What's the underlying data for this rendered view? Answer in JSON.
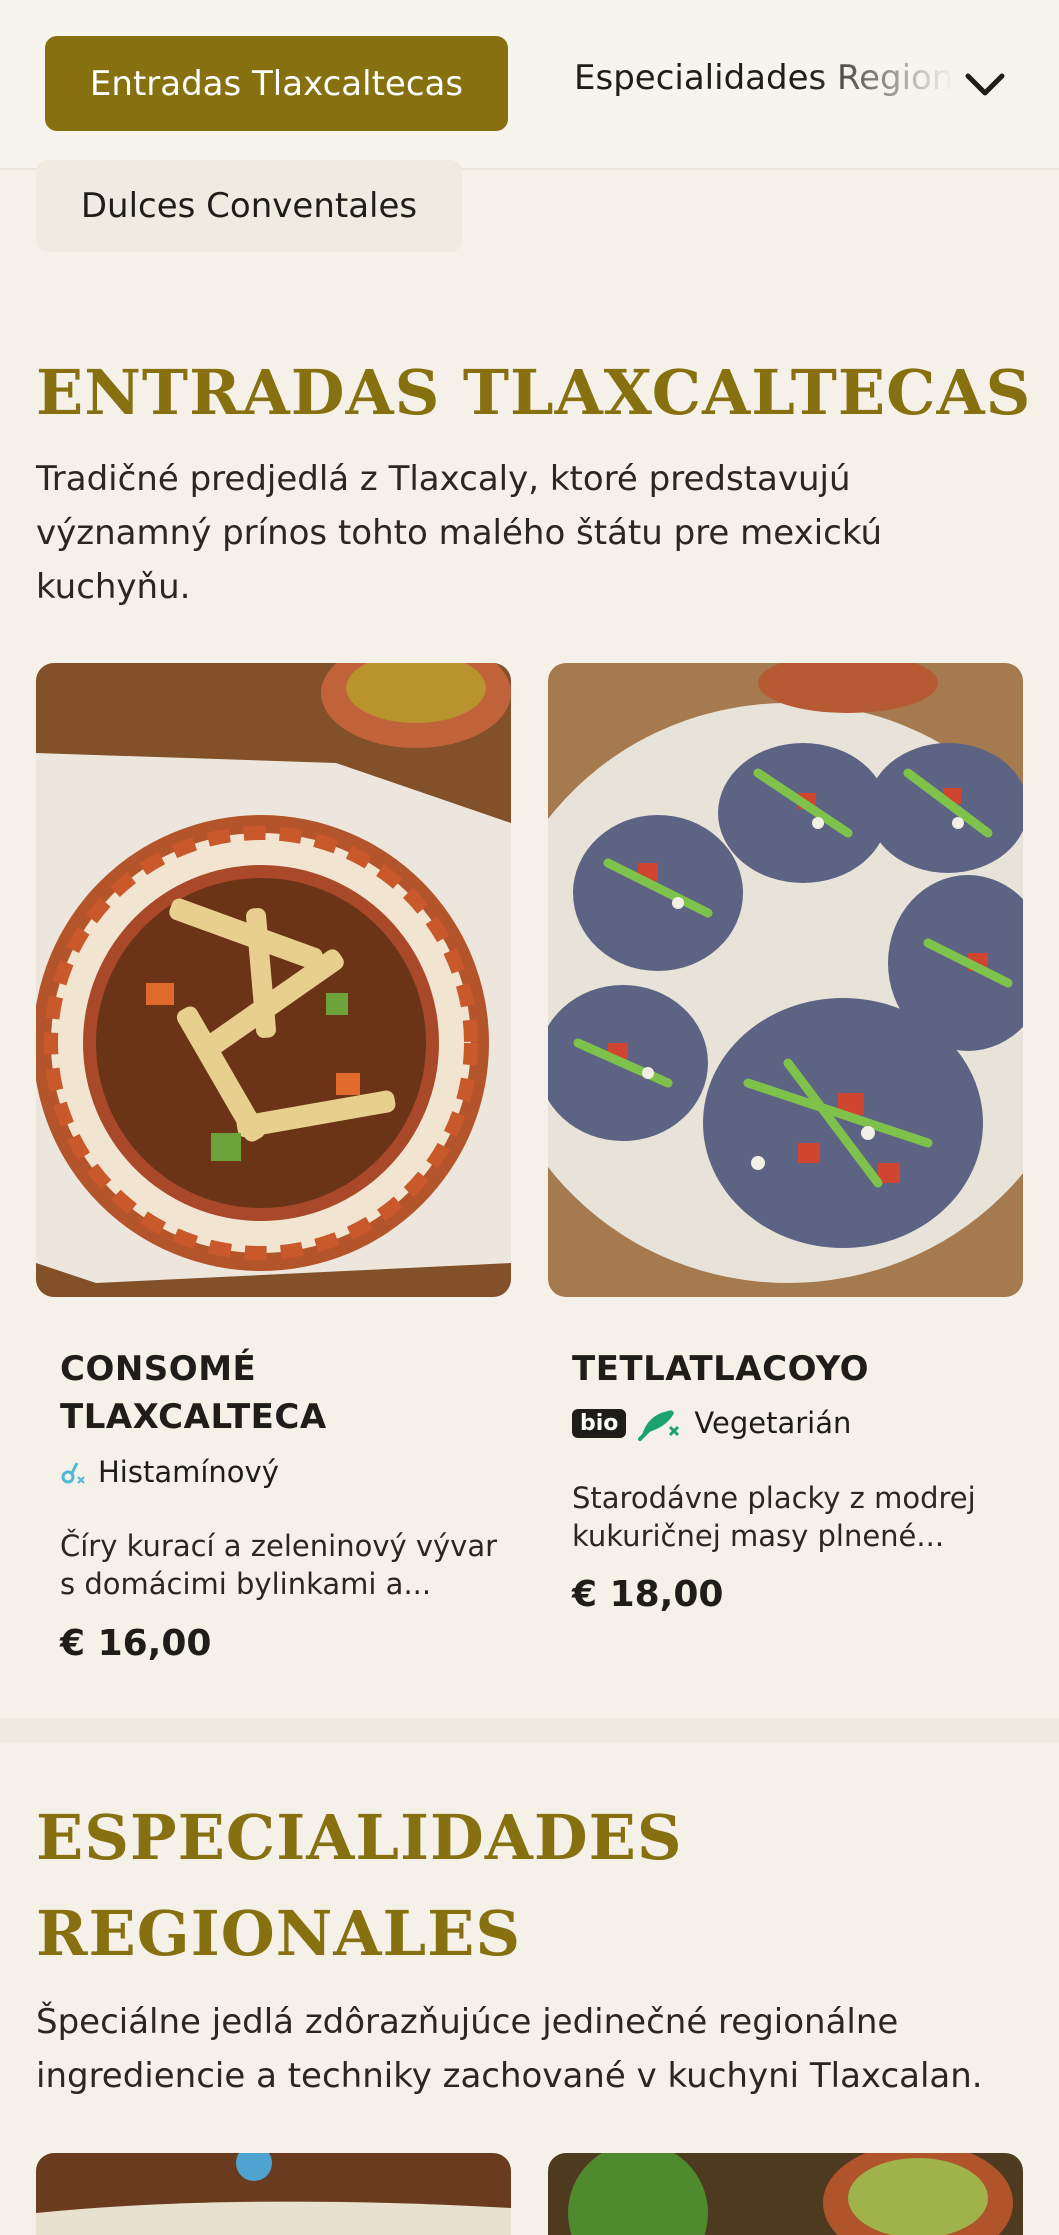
{
  "categories": {
    "active": "Entradas Tlaxcaltecas",
    "next": "Especialidades Regionales",
    "wrapped": "Dulces Conventales"
  },
  "sections": [
    {
      "title": "Entradas Tlaxcaltecas",
      "description": "Tradičné predjedlá z Tlaxcaly, ktoré predstavujú významný prínos tohto malého štátu pre mexickú kuchyňu.",
      "dishes": [
        {
          "name": "CONSOMÉ TLAXCALTECA",
          "tags": [
            {
              "icon": "histamine-icon",
              "label": "Histamínový"
            }
          ],
          "description": "Číry kurací a zeleninový vývar s domácimi bylinkami a...",
          "price": "€ 16,00"
        },
        {
          "name": "TETLATLACOYO",
          "badge": "bio",
          "tags": [
            {
              "icon": "vegetarian-icon",
              "label": "Vegetarián"
            }
          ],
          "description": "Starodávne placky z modrej kukuričnej masy plnené...",
          "price": "€ 18,00"
        }
      ]
    },
    {
      "title": "Especialidades Regionales",
      "description": "Špeciálne jedlá zdôrazňujúce jedinečné regionálne ingrediencie a techniky zachované v kuchyni Tlaxcalan."
    }
  ],
  "colors": {
    "accent": "#86700f",
    "background": "#f5f1e9",
    "vegetarian": "#1aa36b",
    "histamine": "#4fb7d6"
  }
}
